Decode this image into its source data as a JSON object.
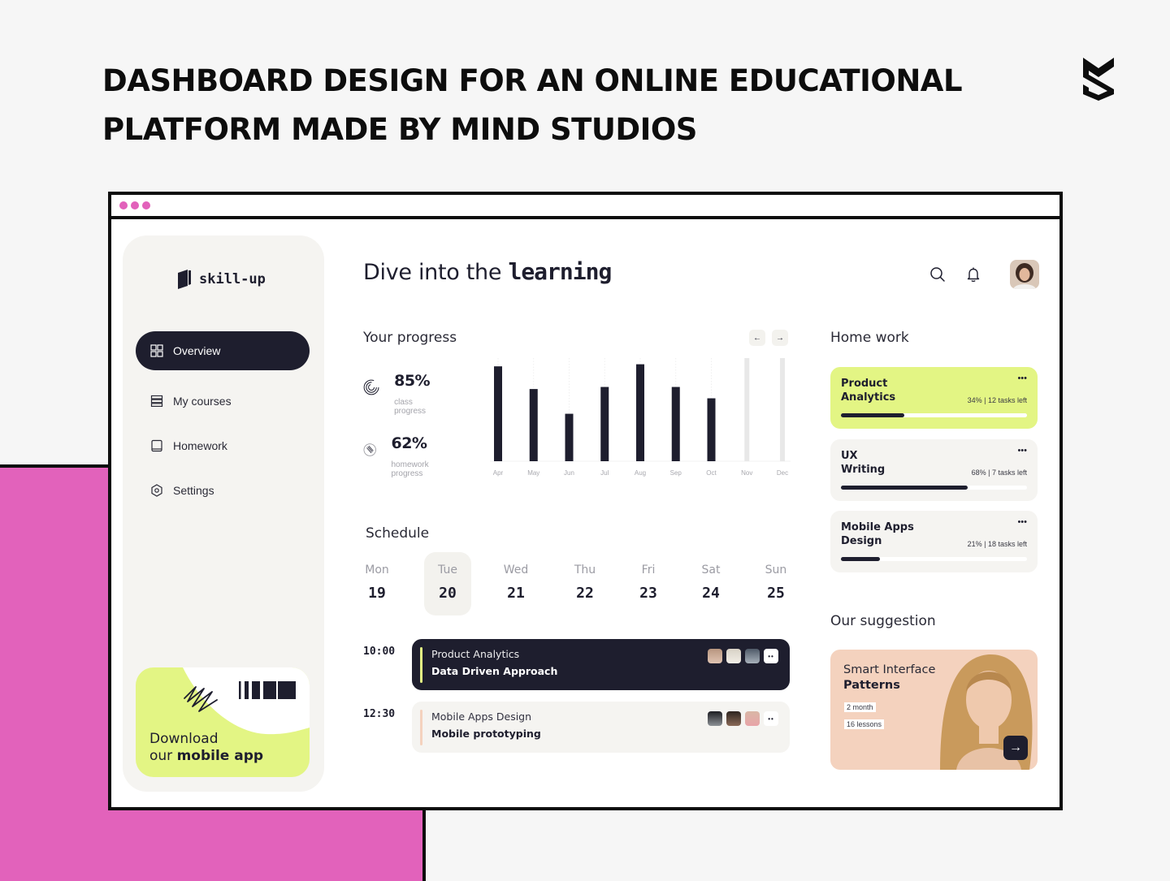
{
  "page": {
    "headline_line1": "DASHBOARD DESIGN FOR AN ONLINE EDUCATIONAL",
    "headline_line2": "PLATFORM MADE BY MIND STUDIOS",
    "brand_logo": "mind-studios-logo",
    "accent_pink": "#e262bb"
  },
  "app": {
    "logo_text": "skill-up",
    "colors": {
      "dark": "#1e1e2e",
      "lime": "#e3f584",
      "panel": "#f5f4f1",
      "peach": "#f4d2be"
    }
  },
  "sidebar": {
    "items": [
      {
        "label": "Overview",
        "icon": "grid-icon",
        "active": true
      },
      {
        "label": "My courses",
        "icon": "stack-icon",
        "active": false
      },
      {
        "label": "Homework",
        "icon": "book-icon",
        "active": false
      },
      {
        "label": "Settings",
        "icon": "hexagon-gear-icon",
        "active": false
      }
    ],
    "promo": {
      "line1": "Download",
      "line2_prefix": "our ",
      "line2_bold": "mobile app"
    }
  },
  "header": {
    "greeting_prefix": "Dive into the ",
    "greeting_bold": "learning",
    "icons": [
      "search-icon",
      "bell-icon",
      "user-avatar"
    ]
  },
  "progress": {
    "title": "Your progress",
    "prev_label": "←",
    "next_label": "→",
    "stats": [
      {
        "value": "85%",
        "label": "class progress",
        "icon": "concentric-arcs-icon"
      },
      {
        "value": "62%",
        "label": "homework progress",
        "icon": "striped-circle-icon"
      }
    ]
  },
  "chart_data": {
    "type": "bar",
    "title": "Your progress",
    "xlabel": "",
    "ylabel": "",
    "ylim": [
      0,
      100
    ],
    "grid": "vertical-dotted",
    "categories": [
      "Apr",
      "May",
      "Jun",
      "Jul",
      "Aug",
      "Sep",
      "Oct",
      "Nov",
      "Dec"
    ],
    "values": [
      92,
      70,
      46,
      72,
      94,
      72,
      61,
      null,
      null
    ],
    "placeholder_categories": [
      "Nov",
      "Dec"
    ],
    "bar_color": "#1e1e2e",
    "placeholder_color": "#e8e8e8"
  },
  "schedule": {
    "title": "Schedule",
    "days": [
      {
        "name": "Mon",
        "num": "19",
        "selected": false
      },
      {
        "name": "Tue",
        "num": "20",
        "selected": true
      },
      {
        "name": "Wed",
        "num": "21",
        "selected": false
      },
      {
        "name": "Thu",
        "num": "22",
        "selected": false
      },
      {
        "name": "Fri",
        "num": "23",
        "selected": false
      },
      {
        "name": "Sat",
        "num": "24",
        "selected": false
      },
      {
        "name": "Sun",
        "num": "25",
        "selected": false
      }
    ],
    "events": [
      {
        "time": "10:00",
        "course": "Product Analytics",
        "topic": "Data Driven Approach",
        "style": "dark",
        "accent": "#e3f584",
        "more_label": "••"
      },
      {
        "time": "12:30",
        "course": "Mobile Apps Design",
        "topic": "Mobile prototyping",
        "style": "light",
        "accent": "#f4d2be",
        "more_label": "••"
      }
    ]
  },
  "homework": {
    "title": "Home work",
    "items": [
      {
        "title": "Product Analytics",
        "meta": "34% | 12 tasks left",
        "progress": 34,
        "active": true,
        "more_label": "•••"
      },
      {
        "title": "UX Writing",
        "meta": "68% | 7 tasks left",
        "progress": 68,
        "active": false,
        "more_label": "•••"
      },
      {
        "title": "Mobile Apps Design",
        "meta": "21% | 18 tasks left",
        "progress": 21,
        "active": false,
        "more_label": "•••"
      }
    ]
  },
  "suggestion": {
    "title": "Our suggestion",
    "course_line1": "Smart Interface",
    "course_line2": "Patterns",
    "duration": "2 month",
    "lessons": "16 lessons",
    "go_label": "→"
  }
}
